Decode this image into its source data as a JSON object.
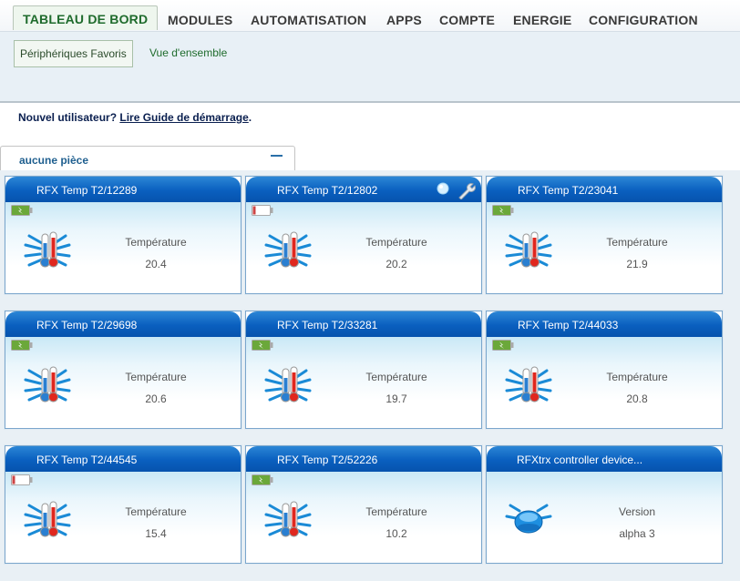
{
  "nav": {
    "tabs": [
      "TABLEAU DE BORD",
      "MODULES",
      "AUTOMATISATION",
      "APPS",
      "COMPTE",
      "ENERGIE",
      "CONFIGURATION"
    ]
  },
  "subnav": {
    "items": [
      "Périphériques Favoris",
      "Vue d'ensemble"
    ]
  },
  "guide": {
    "prefix": "Nouvel utilisateur? ",
    "link": "Lire Guide de démarrage",
    "suffix": "."
  },
  "room": {
    "name": "aucune pièce"
  },
  "colors": {
    "header_blue": "#0a5fbf",
    "nav_active_green": "#1e6b2c",
    "battery_ok": "#6ba83a",
    "battery_low": "#c44"
  },
  "cards": [
    {
      "title": "RFX Temp T2/12289",
      "label": "Température",
      "value": "20.4",
      "battery": "ok",
      "icon": "thermometer-icon"
    },
    {
      "title": "RFX Temp T2/12802",
      "label": "Température",
      "value": "20.2",
      "battery": "low",
      "icon": "thermometer-icon",
      "extra_icons": [
        "info-bubble-icon",
        "wrench-icon"
      ]
    },
    {
      "title": "RFX Temp T2/23041",
      "label": "Température",
      "value": "21.9",
      "battery": "ok",
      "icon": "thermometer-icon"
    },
    {
      "title": "RFX Temp T2/29698",
      "label": "Température",
      "value": "20.6",
      "battery": "ok",
      "icon": "thermometer-icon"
    },
    {
      "title": "RFX Temp T2/33281",
      "label": "Température",
      "value": "19.7",
      "battery": "ok",
      "icon": "thermometer-icon"
    },
    {
      "title": "RFX Temp T2/44033",
      "label": "Température",
      "value": "20.8",
      "battery": "ok",
      "icon": "thermometer-icon"
    },
    {
      "title": "RFX Temp T2/44545",
      "label": "Température",
      "value": "15.4",
      "battery": "low",
      "icon": "thermometer-icon"
    },
    {
      "title": "RFX Temp T2/52226",
      "label": "Température",
      "value": "10.2",
      "battery": "ok",
      "icon": "thermometer-icon"
    },
    {
      "title": "RFXtrx controller device...",
      "label": "Version",
      "value": "alpha 3",
      "battery": "none",
      "icon": "controller-globe-icon"
    }
  ]
}
